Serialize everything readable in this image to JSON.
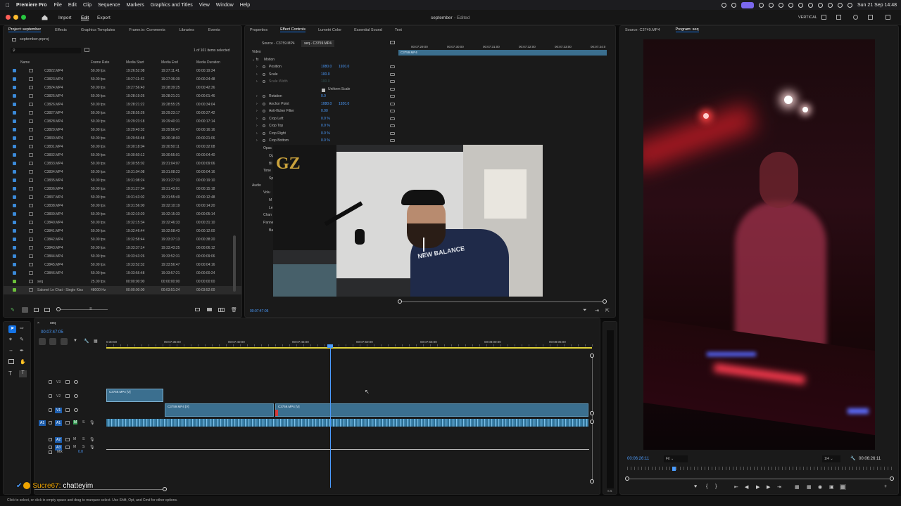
{
  "menubar": {
    "app": "Premiere Pro",
    "items": [
      "File",
      "Edit",
      "Clip",
      "Sequence",
      "Markers",
      "Graphics and Titles",
      "View",
      "Window",
      "Help"
    ],
    "datetime": "Sun 21 Sep  14:48"
  },
  "titlebar": {
    "nav": [
      "Import",
      "Edit",
      "Export"
    ],
    "title": "september",
    "status": "- Edited",
    "layout": "VERTICAL"
  },
  "project": {
    "tabs": [
      "Project: september",
      "Effects",
      "Graphics Templates",
      "Frame.io: Comments",
      "Libraries",
      "Events"
    ],
    "file": "september.prproj",
    "count": "1 of 101 items selected",
    "columns": [
      "Name",
      "Frame Rate",
      "Media Start",
      "Media End",
      "Media Duration"
    ],
    "rows": [
      [
        "C3822.MP4",
        "50.00 fps",
        "19:26:52:08",
        "19:27:11:41",
        "00:00:19:34"
      ],
      [
        "C3823.MP4",
        "50.00 fps",
        "19:27:11:42",
        "19:27:36:39",
        "00:00:24:48"
      ],
      [
        "C3824.MP4",
        "50.00 fps",
        "19:27:56:40",
        "19:28:39:25",
        "00:00:42:36"
      ],
      [
        "C3825.MP4",
        "50.00 fps",
        "19:28:19:26",
        "19:28:21:21",
        "00:00:01:46"
      ],
      [
        "C3826.MP4",
        "50.00 fps",
        "19:28:21:22",
        "19:28:55:25",
        "00:00:34:04"
      ],
      [
        "C3827.MP4",
        "50.00 fps",
        "19:28:55:26",
        "19:29:23:17",
        "00:00:27:42"
      ],
      [
        "C3828.MP4",
        "50.00 fps",
        "19:29:23:18",
        "19:29:40:31",
        "00:00:17:14"
      ],
      [
        "C3829.MP4",
        "50.00 fps",
        "19:29:40:32",
        "19:29:56:47",
        "00:00:16:16"
      ],
      [
        "C3830.MP4",
        "50.00 fps",
        "19:29:56:48",
        "19:30:18:03",
        "00:00:21:06"
      ],
      [
        "C3831.MP4",
        "50.00 fps",
        "19:30:18:04",
        "19:30:50:11",
        "00:00:32:08"
      ],
      [
        "C3832.MP4",
        "50.00 fps",
        "19:30:50:12",
        "19:30:55:01",
        "00:00:04:40"
      ],
      [
        "C3833.MP4",
        "50.00 fps",
        "19:30:55:02",
        "19:31:04:07",
        "00:00:09:06"
      ],
      [
        "C3834.MP4",
        "50.00 fps",
        "19:31:04:08",
        "19:31:08:23",
        "00:00:04:16"
      ],
      [
        "C3835.MP4",
        "50.00 fps",
        "19:31:08:24",
        "19:31:27:33",
        "00:00:19:10"
      ],
      [
        "C3836.MP4",
        "50.00 fps",
        "19:31:27:34",
        "19:31:43:01",
        "00:00:15:18"
      ],
      [
        "C3837.MP4",
        "50.00 fps",
        "19:31:43:02",
        "19:31:55:49",
        "00:00:12:48"
      ],
      [
        "C3838.MP4",
        "50.00 fps",
        "19:31:56:00",
        "19:32:10:19",
        "00:00:14:20"
      ],
      [
        "C3839.MP4",
        "50.00 fps",
        "19:32:10:20",
        "19:32:15:33",
        "00:00:05:14"
      ],
      [
        "C3840.MP4",
        "50.00 fps",
        "19:32:15:34",
        "19:32:46:33",
        "00:00:31:10"
      ],
      [
        "C3841.MP4",
        "50.00 fps",
        "19:32:46:44",
        "19:32:58:43",
        "00:00:12:00"
      ],
      [
        "C3842.MP4",
        "50.00 fps",
        "19:32:58:44",
        "19:33:37:13",
        "00:00:38:20"
      ],
      [
        "C3843.MP4",
        "50.00 fps",
        "19:33:37:14",
        "19:33:43:25",
        "00:00:06:12"
      ],
      [
        "C3844.MP4",
        "50.00 fps",
        "19:33:43:26",
        "19:33:52:31",
        "00:00:09:06"
      ],
      [
        "C3845.MP4",
        "50.00 fps",
        "19:33:52:32",
        "19:33:56:47",
        "00:00:04:16"
      ],
      [
        "C3846.MP4",
        "50.00 fps",
        "19:33:56:48",
        "19:33:57:21",
        "00:00:00:24"
      ],
      [
        "seq",
        "25.00 fps",
        "00:00:00:00",
        "00:00:00:00",
        "00:00:00:00"
      ],
      [
        "Salomé Le Chat - Single Kiss",
        "48000 Hz",
        "00:00:00:00",
        "00:03:51:24",
        "00:03:52:00"
      ]
    ]
  },
  "effects": {
    "tabs": [
      "Properties",
      "Effect Controls",
      "Lumetri Color",
      "Essential Sound",
      "Text"
    ],
    "source_tab": "Source - C3759.MP4",
    "seq_tab": "seq - C3759.MP4",
    "clip": "C3759.MP4",
    "ticks": [
      "00:07:29:00",
      "00:07:30:00",
      "00:07:31:00",
      "00:07:32:00",
      "00:07:33:00",
      "00:07:34:0"
    ],
    "section": "Video",
    "motion": "Motion",
    "props": [
      {
        "name": "Position",
        "v1": "1080.0",
        "v2": "1920.0"
      },
      {
        "name": "Scale",
        "v1": "100.0",
        "v2": ""
      },
      {
        "name": "Scale Width",
        "v1": "100.0",
        "v2": ""
      },
      {
        "name": "Uniform Scale",
        "v1": "",
        "v2": ""
      },
      {
        "name": "Rotation",
        "v1": "0.0",
        "v2": ""
      },
      {
        "name": "Anchor Point",
        "v1": "1080.0",
        "v2": "1920.0"
      },
      {
        "name": "Anti-flicker Filter",
        "v1": "0.00",
        "v2": ""
      },
      {
        "name": "Crop Left",
        "v1": "0.0 %",
        "v2": ""
      },
      {
        "name": "Crop Top",
        "v1": "0.0 %",
        "v2": ""
      },
      {
        "name": "Crop Right",
        "v1": "0.0 %",
        "v2": ""
      },
      {
        "name": "Crop Bottom",
        "v1": "0.0 %",
        "v2": ""
      }
    ],
    "partial": [
      "Opac",
      "Op",
      "Bl",
      "Time",
      "Sp",
      "Audio",
      "Volu",
      "M",
      "Le",
      "Chan",
      "Panne",
      "Ba"
    ],
    "timecode": "00:07:47:05"
  },
  "program": {
    "tabs": [
      "Source: C3749.MP4",
      "Program: seq"
    ],
    "timecode": "00:06:26:11",
    "fit": "Fit",
    "ratio": "1/4",
    "duration": "00:06:26:11"
  },
  "timeline": {
    "seq": "seq",
    "timecode": "00:07:47:05",
    "ruler": [
      "0:30:00",
      "00:07:35:00",
      "00:07:40:00",
      "00:07:45:00",
      "00:07:50:00",
      "00:07:55:00",
      "00:08:00:00",
      "00:08:05:00"
    ],
    "tracks": [
      "V3",
      "V2",
      "V1",
      "A1",
      "A2",
      "A3"
    ],
    "mix": "Mix",
    "mix_val": "0.0",
    "clips": [
      "C3759.MP4 [V]",
      "C3759.MP4 [V]",
      "C3759.MP4 [V]"
    ]
  },
  "chat": {
    "user": "Sucre67:",
    "message": "chatteyim"
  },
  "statusbar": "Click to select, or click in empty space and drag to marquee select. Use Shift, Opt, and Cmd for other options."
}
